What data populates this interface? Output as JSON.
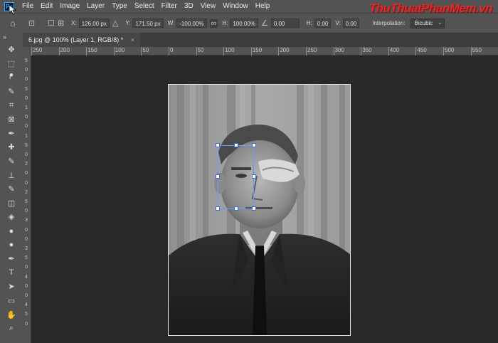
{
  "app": {
    "logo_text": "Ps"
  },
  "menu": [
    "File",
    "Edit",
    "Image",
    "Layer",
    "Type",
    "Select",
    "Filter",
    "3D",
    "View",
    "Window",
    "Help"
  ],
  "watermark": "ThuThuatPhanMem.vn",
  "options": {
    "x_label": "X:",
    "x_value": "126.00 px",
    "y_label": "Y:",
    "y_value": "171.50 px",
    "w_label": "W:",
    "w_value": "-100.00%",
    "h_label": "H:",
    "h_value": "100.00%",
    "angle_value": "0.00",
    "hskew_label": "H:",
    "hskew_value": "0.00",
    "vskew_label": "V:",
    "vskew_value": "0.00",
    "interp_label": "Interpolation:",
    "interp_value": "Bicubic"
  },
  "document_tab": {
    "title": "6.jpg @ 100% (Layer 1, RGB/8) *",
    "close": "×"
  },
  "ruler_h_labels": [
    "250",
    "200",
    "150",
    "100",
    "50",
    "0",
    "50",
    "100",
    "150",
    "200",
    "250",
    "300",
    "350",
    "400",
    "450",
    "500",
    "550"
  ],
  "ruler_v_labels": [
    "5",
    "0",
    "0",
    "5",
    "0",
    "1",
    "0",
    "0",
    "1",
    "5",
    "0",
    "2",
    "0",
    "0",
    "2",
    "5",
    "0",
    "3",
    "0",
    "0",
    "3",
    "5",
    "0",
    "4",
    "0",
    "0",
    "4",
    "5",
    "0"
  ],
  "tools": [
    "move-icon",
    "marquee-icon",
    "lasso-icon",
    "quick-select-icon",
    "crop-icon",
    "frame-icon",
    "eyedropper-icon",
    "healing-icon",
    "brush-icon",
    "stamp-icon",
    "history-brush-icon",
    "eraser-icon",
    "paint-bucket-icon",
    "blur-icon",
    "dodge-icon",
    "pen-icon",
    "type-icon",
    "path-select-icon",
    "rectangle-icon",
    "hand-icon",
    "zoom-icon"
  ],
  "tool_glyphs": [
    "✥",
    "⬚",
    "ᖰ",
    "✎",
    "⌗",
    "⊠",
    "✒",
    "✚",
    "✎",
    "⊥",
    "✎",
    "◫",
    "◈",
    "●",
    "●",
    "✒",
    "T",
    "➤",
    "▭",
    "✋",
    "⌕"
  ]
}
